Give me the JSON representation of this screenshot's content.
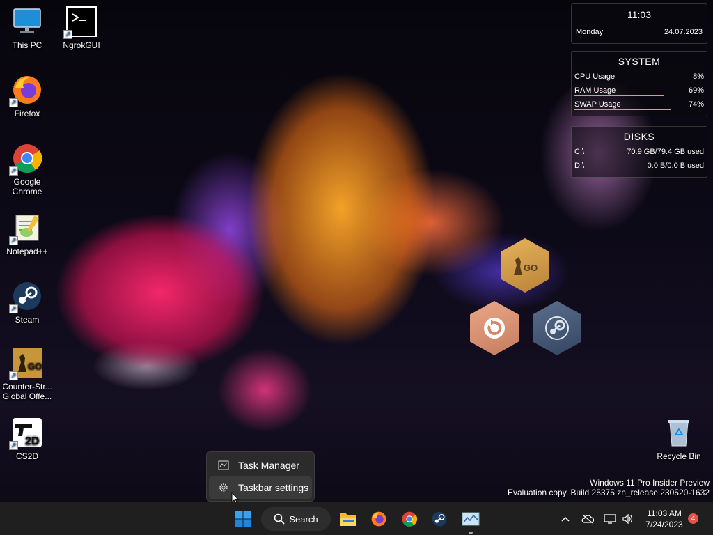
{
  "desktop": {
    "icons": [
      {
        "label": "This PC",
        "icon": "monitor-icon"
      },
      {
        "label": "NgrokGUI",
        "icon": "terminal-icon"
      },
      {
        "label": "Firefox",
        "icon": "firefox-icon"
      },
      {
        "label": "Google Chrome",
        "icon": "chrome-icon"
      },
      {
        "label": "Notepad++",
        "icon": "notepadpp-icon"
      },
      {
        "label": "Steam",
        "icon": "steam-icon"
      },
      {
        "label": "Counter-Str... Global Offe...",
        "icon": "csgo-icon"
      },
      {
        "label": "CS2D",
        "icon": "cs2d-icon"
      },
      {
        "label": "Recycle Bin",
        "icon": "recycle-bin-icon"
      }
    ]
  },
  "clock_widget": {
    "time": "11:03",
    "day": "Monday",
    "date": "24.07.2023"
  },
  "system_widget": {
    "title": "SYSTEM",
    "rows": [
      {
        "label": "CPU Usage",
        "value": "8%",
        "fraction": 0.08
      },
      {
        "label": "RAM Usage",
        "value": "69%",
        "fraction": 0.69
      },
      {
        "label": "SWAP Usage",
        "value": "74%",
        "fraction": 0.74
      }
    ]
  },
  "disks_widget": {
    "title": "DISKS",
    "rows": [
      {
        "label": "C:\\",
        "value": "70.9 GB/79.4 GB used",
        "fraction": 0.893
      },
      {
        "label": "D:\\",
        "value": "0.0 B/0.0 B used",
        "fraction": 0
      }
    ]
  },
  "context_menu": {
    "items": [
      {
        "label": "Task Manager",
        "icon": "task-manager-icon"
      },
      {
        "label": "Taskbar settings",
        "icon": "gear-icon"
      }
    ]
  },
  "watermark": {
    "line1": "Windows 11 Pro Insider Preview",
    "line2": "Evaluation copy. Build 25375.zn_release.230520-1632"
  },
  "taskbar": {
    "search_label": "Search",
    "time": "11:03 AM",
    "date": "7/24/2023",
    "notification_count": "4",
    "pinned": [
      "file-explorer-icon",
      "firefox-icon",
      "chrome-icon",
      "steam-icon",
      "task-manager-icon"
    ]
  },
  "colors": {
    "accent": "#0078d4",
    "widget_bar": "#e8a33c",
    "taskbar": "#1f1f1f",
    "badge": "#e8504a"
  }
}
